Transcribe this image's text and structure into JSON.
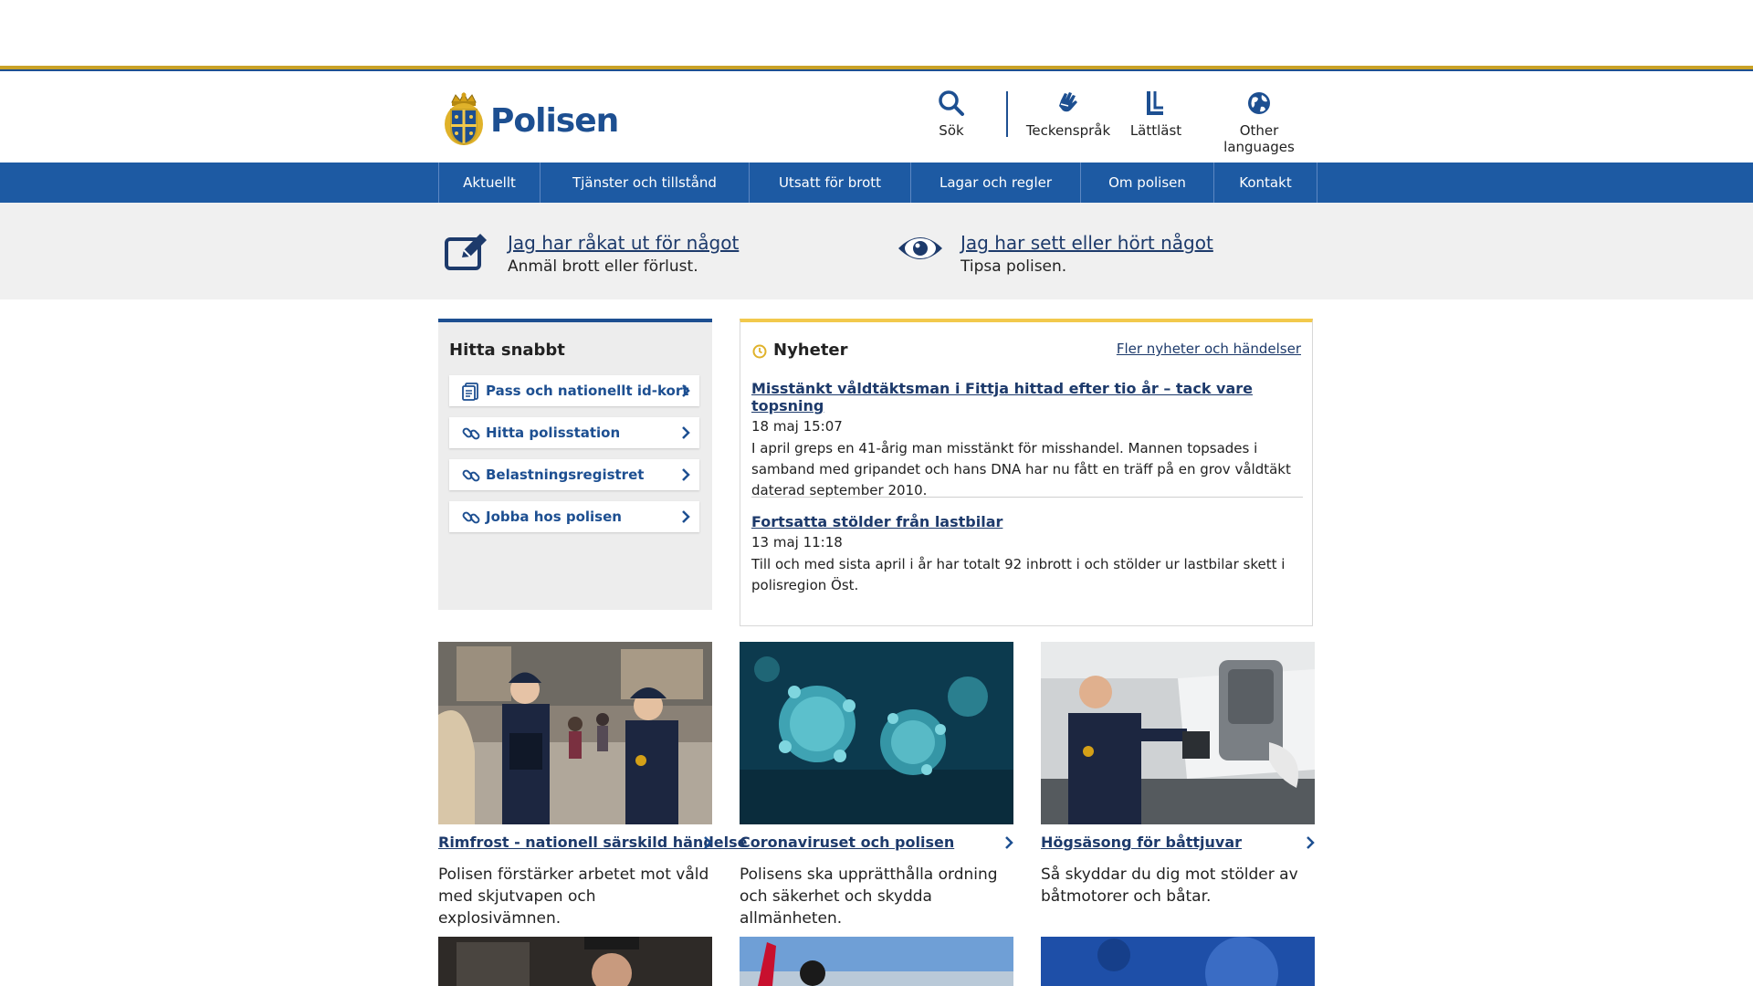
{
  "header": {
    "logo_text": "Polisen",
    "tools": [
      {
        "label": "Sök",
        "icon": "search-icon"
      },
      {
        "label": "Teckenspråk",
        "icon": "sign-language-icon"
      },
      {
        "label": "Lättläst",
        "icon": "easy-read-icon"
      },
      {
        "label": "Other languages",
        "icon": "globe-icon"
      }
    ]
  },
  "nav": {
    "items": [
      "Aktuellt",
      "Tjänster och tillstånd",
      "Utsatt för brott",
      "Lagar och regler",
      "Om polisen",
      "Kontakt"
    ]
  },
  "report": {
    "left": {
      "title": "Jag har råkat ut för något",
      "sub": "Anmäl brott eller förlust.",
      "icon": "edit-icon"
    },
    "right": {
      "title": "Jag har sett eller hört något",
      "sub": "Tipsa polisen.",
      "icon": "eye-icon"
    }
  },
  "quick": {
    "title": "Hitta snabbt",
    "links": [
      {
        "label": "Pass och nationellt id-kort",
        "icon": "document-icon"
      },
      {
        "label": "Hitta polisstation",
        "icon": "link-icon"
      },
      {
        "label": "Belastningsregistret",
        "icon": "link-icon"
      },
      {
        "label": "Jobba hos polisen",
        "icon": "link-icon"
      }
    ]
  },
  "news": {
    "title": "Nyheter",
    "more": "Fler nyheter och händelser",
    "items": [
      {
        "title": "Misstänkt våldtäktsman i Fittja hittad efter tio år – tack vare topsning",
        "date": "18 maj 15:07",
        "text": "I april greps en 41-årig man misstänkt för misshandel. Mannen topsades i samband med gripandet och hans DNA har nu fått en träff på en grov våldtäkt daterad september 2010."
      },
      {
        "title": "Fortsatta stölder från lastbilar",
        "date": "13 maj 11:18",
        "text": "Till och med sista april i år har totalt 92 inbrott i och stölder ur lastbilar skett i polisregion Öst."
      }
    ]
  },
  "cards": [
    {
      "title": "Rimfrost - nationell särskild händelse",
      "text": "Polisen förstärker arbetet mot våld med skjutvapen och explosivämnen."
    },
    {
      "title": "Coronaviruset och polisen",
      "text": "Polisens ska upprätthålla ordning och säkerhet och skydda allmänheten."
    },
    {
      "title": "Högsäsong för båttjuvar",
      "text": "Så skyddar du dig mot stölder av båtmotorer och båtar."
    }
  ],
  "colors": {
    "brand_blue": "#1d4f91",
    "nav_blue": "#1d5aa3",
    "gold": "#c9a227",
    "news_accent": "#f2c94c"
  }
}
